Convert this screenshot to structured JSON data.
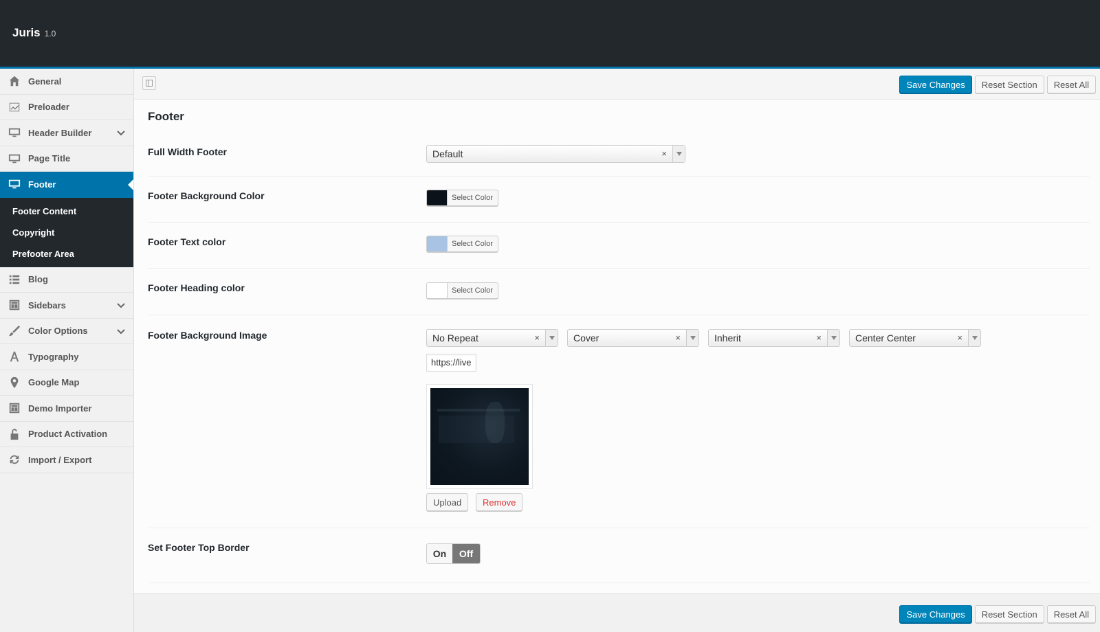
{
  "header": {
    "brand": "Juris",
    "version": "1.0"
  },
  "sidebar": {
    "items": [
      {
        "label": "General",
        "icon": "home-icon"
      },
      {
        "label": "Preloader",
        "icon": "chart-icon"
      },
      {
        "label": "Header Builder",
        "icon": "monitor-icon",
        "has_children": true
      },
      {
        "label": "Page Title",
        "icon": "monitor-icon"
      },
      {
        "label": "Footer",
        "icon": "monitor-icon",
        "active": true
      },
      {
        "label": "Blog",
        "icon": "list-icon"
      },
      {
        "label": "Sidebars",
        "icon": "layout-icon",
        "has_children": true
      },
      {
        "label": "Color Options",
        "icon": "brush-icon",
        "has_children": true
      },
      {
        "label": "Typography",
        "icon": "typography-icon"
      },
      {
        "label": "Google Map",
        "icon": "map-pin-icon"
      },
      {
        "label": "Demo Importer",
        "icon": "layout-icon"
      },
      {
        "label": "Product Activation",
        "icon": "unlock-icon"
      },
      {
        "label": "Import / Export",
        "icon": "refresh-icon"
      }
    ],
    "footer_sub": [
      "Footer Content",
      "Copyright",
      "Prefooter Area"
    ]
  },
  "toolbar": {
    "save_label": "Save Changes",
    "reset_section_label": "Reset Section",
    "reset_all_label": "Reset All"
  },
  "section": {
    "title": "Footer",
    "full_width_footer": {
      "label": "Full Width Footer",
      "value": "Default"
    },
    "bg_color": {
      "label": "Footer Background Color",
      "button": "Select Color",
      "color": "#0b121a"
    },
    "text_color": {
      "label": "Footer Text color",
      "button": "Select Color",
      "color": "#a8c3e3"
    },
    "heading_color": {
      "label": "Footer Heading color",
      "button": "Select Color",
      "color": "#ffffff"
    },
    "bg_image": {
      "label": "Footer Background Image",
      "repeat": "No Repeat",
      "size": "Cover",
      "attachment": "Inherit",
      "position": "Center Center",
      "url": "https://live",
      "upload_label": "Upload",
      "remove_label": "Remove"
    },
    "top_border": {
      "label": "Set Footer Top Border",
      "on_label": "On",
      "off_label": "Off",
      "value": "off"
    }
  },
  "colors": {
    "accent": "#0073aa",
    "primary_button": "#0085ba",
    "remove": "#dd3333"
  }
}
